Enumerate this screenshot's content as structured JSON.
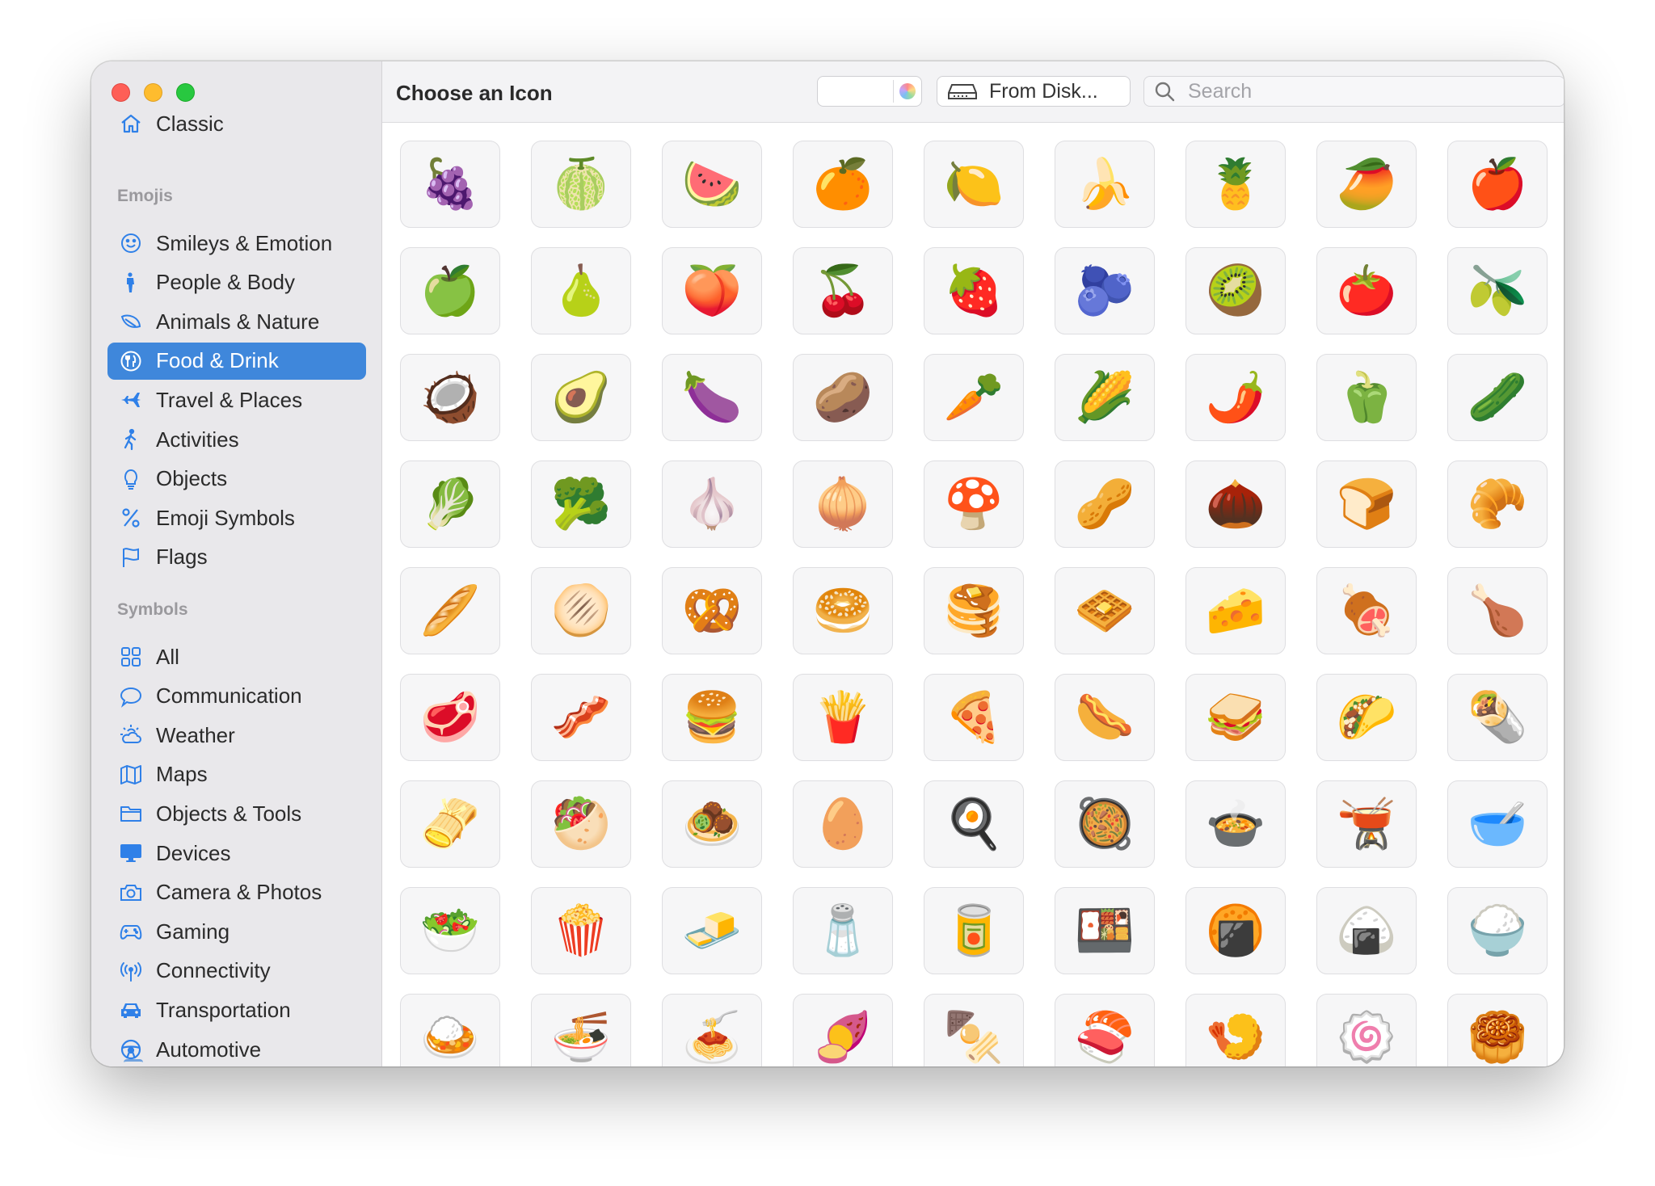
{
  "window": {
    "title": "Choose an Icon",
    "from_disk_label": "From Disk...",
    "search_placeholder": "Search"
  },
  "sidebar": {
    "classic": "Classic",
    "emojis_header": "Emojis",
    "emoji_items": [
      {
        "label": "Smileys & Emotion",
        "icon": "smiley-icon"
      },
      {
        "label": "People & Body",
        "icon": "person-icon"
      },
      {
        "label": "Animals & Nature",
        "icon": "leaf-icon"
      },
      {
        "label": "Food & Drink",
        "icon": "fork-knife-icon",
        "selected": true
      },
      {
        "label": "Travel & Places",
        "icon": "airplane-icon"
      },
      {
        "label": "Activities",
        "icon": "running-icon"
      },
      {
        "label": "Objects",
        "icon": "lightbulb-icon"
      },
      {
        "label": "Emoji Symbols",
        "icon": "percent-icon"
      },
      {
        "label": "Flags",
        "icon": "flag-icon"
      }
    ],
    "symbols_header": "Symbols",
    "symbol_items": [
      {
        "label": "All",
        "icon": "grid-icon"
      },
      {
        "label": "Communication",
        "icon": "speech-bubble-icon"
      },
      {
        "label": "Weather",
        "icon": "sun-cloud-icon"
      },
      {
        "label": "Maps",
        "icon": "map-icon"
      },
      {
        "label": "Objects & Tools",
        "icon": "folder-icon"
      },
      {
        "label": "Devices",
        "icon": "display-icon"
      },
      {
        "label": "Camera & Photos",
        "icon": "camera-icon"
      },
      {
        "label": "Gaming",
        "icon": "gamecontroller-icon"
      },
      {
        "label": "Connectivity",
        "icon": "antenna-icon"
      },
      {
        "label": "Transportation",
        "icon": "car-icon"
      },
      {
        "label": "Automotive",
        "icon": "steering-wheel-icon"
      }
    ]
  },
  "colors": {
    "accent": "#3f87db",
    "icon_blue": "#2f80e8",
    "sidebar_bg": "#e9e8eb"
  },
  "icons": [
    "🍇",
    "🍈",
    "🍉",
    "🍊",
    "🍋",
    "🍌",
    "🍍",
    "🥭",
    "🍎",
    "🍏",
    "🍐",
    "🍑",
    "🍒",
    "🍓",
    "🫐",
    "🥝",
    "🍅",
    "🫒",
    "🥥",
    "🥑",
    "🍆",
    "🥔",
    "🥕",
    "🌽",
    "🌶️",
    "🫑",
    "🥒",
    "🥬",
    "🥦",
    "🧄",
    "🧅",
    "🍄",
    "🥜",
    "🌰",
    "🍞",
    "🥐",
    "🥖",
    "🫓",
    "🥨",
    "🥯",
    "🥞",
    "🧇",
    "🧀",
    "🍖",
    "🍗",
    "🥩",
    "🥓",
    "🍔",
    "🍟",
    "🍕",
    "🌭",
    "🥪",
    "🌮",
    "🌯",
    "🫔",
    "🥙",
    "🧆",
    "🥚",
    "🍳",
    "🥘",
    "🍲",
    "🫕",
    "🥣",
    "🥗",
    "🍿",
    "🧈",
    "🧂",
    "🥫",
    "🍱",
    "🍘",
    "🍙",
    "🍚",
    "🍛",
    "🍜",
    "🍝",
    "🍠",
    "🍢",
    "🍣",
    "🍤",
    "🍥",
    "🥮"
  ]
}
